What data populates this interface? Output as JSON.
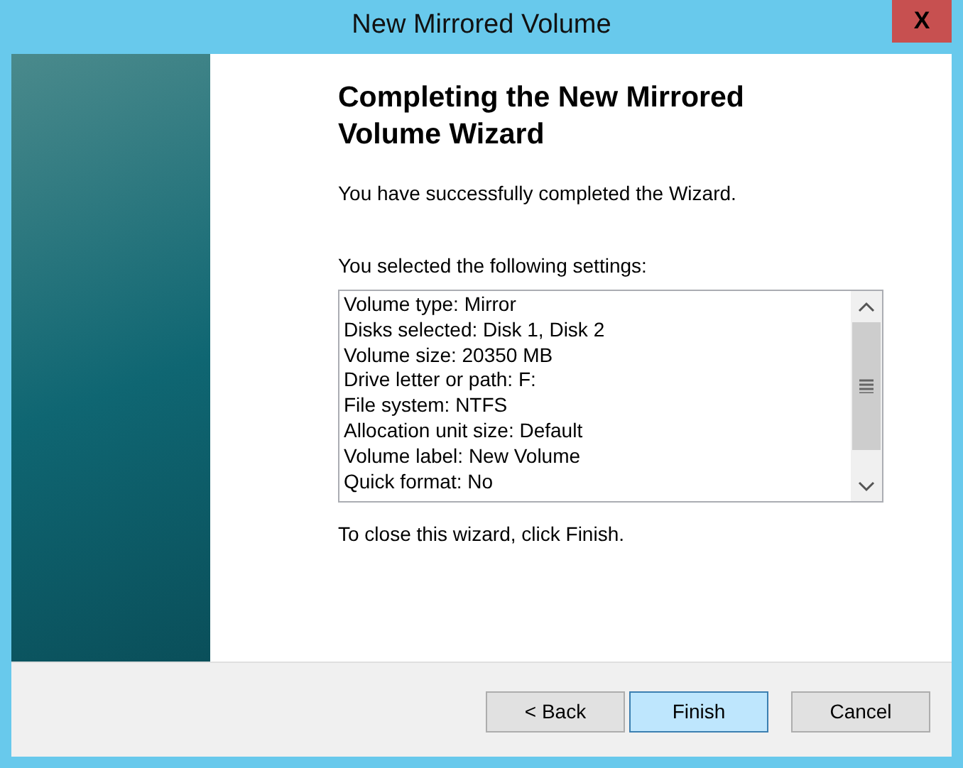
{
  "window": {
    "title": "New Mirrored Volume",
    "close_label": "X"
  },
  "heading": "Completing the New Mirrored Volume Wizard",
  "message": "You have successfully completed the Wizard.",
  "settings_label": "You selected the following settings:",
  "settings": [
    "Volume type: Mirror",
    "Disks selected: Disk 1, Disk 2",
    "Volume size: 20350 MB",
    "Drive letter or path: F:",
    "File system: NTFS",
    "Allocation unit size: Default",
    "Volume label: New Volume",
    "Quick format: No"
  ],
  "close_hint": "To close this wizard, click Finish.",
  "buttons": [
    {
      "label": "< Back",
      "highlighted": false
    },
    {
      "label": "Finish",
      "highlighted": true
    },
    {
      "label": "Cancel",
      "highlighted": false
    }
  ]
}
